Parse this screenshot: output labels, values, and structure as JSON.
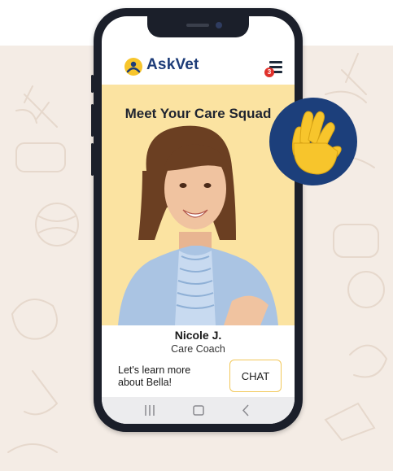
{
  "app": {
    "brand": "AskVet",
    "menu_badge_count": "3"
  },
  "hero": {
    "title": "Meet Your Care Squad"
  },
  "coach": {
    "name": "Nicole J.",
    "role": "Care Coach",
    "prompt": "Let's learn more about Bella!",
    "chat_label": "CHAT"
  },
  "colors": {
    "brand_navy": "#1d3c78",
    "accent_yellow": "#fbe3a1",
    "hand_yellow": "#f7c52c",
    "badge_red": "#e0312b",
    "wave_circle": "#1c3f7b",
    "background": "#f4ece5"
  },
  "icons": [
    "askvet-logo-icon",
    "menu-icon",
    "wave-hand-icon",
    "nav-recents-icon",
    "nav-home-icon",
    "nav-back-icon"
  ]
}
